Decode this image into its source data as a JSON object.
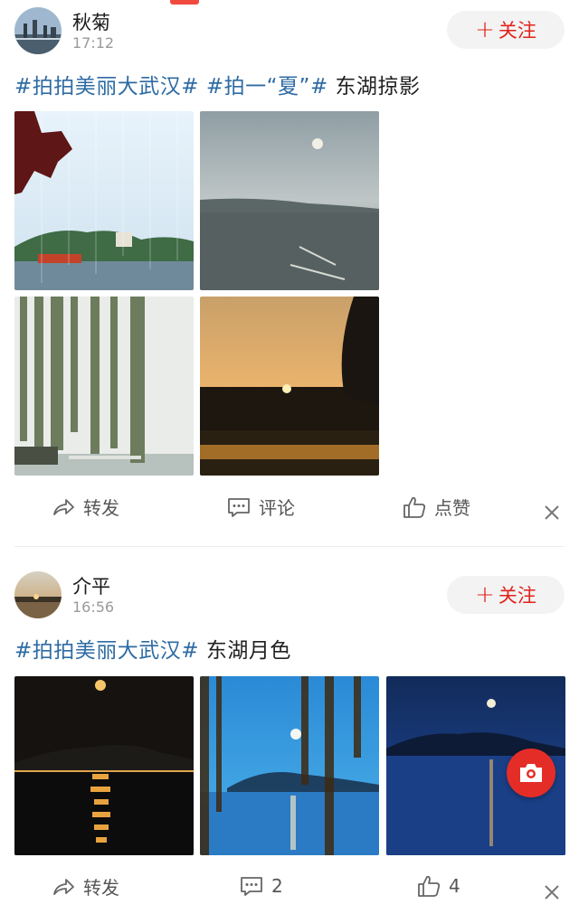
{
  "post1": {
    "user": "秋菊",
    "time": "17:12",
    "follow_label": "关注",
    "tags": [
      "#拍拍美丽大武汉#",
      "#拍一“夏”#"
    ],
    "text": "东湖掠影",
    "actions": {
      "share": "转发",
      "comment": "评论",
      "like": "点赞"
    }
  },
  "post2": {
    "user": "介平",
    "time": "16:56",
    "follow_label": "关注",
    "tags": [
      "#拍拍美丽大武汉#"
    ],
    "text": "东湖月色",
    "actions": {
      "share": "转发",
      "comment": "2",
      "like": "4"
    }
  },
  "colors": {
    "accent": "#e2231a",
    "tag": "#2e6ba3",
    "muted": "#9a9a9a"
  },
  "icons": {
    "share": "share-arrow-icon",
    "comment": "comment-bubble-icon",
    "like": "thumbs-up-icon",
    "close": "close-icon",
    "camera": "camera-icon"
  }
}
